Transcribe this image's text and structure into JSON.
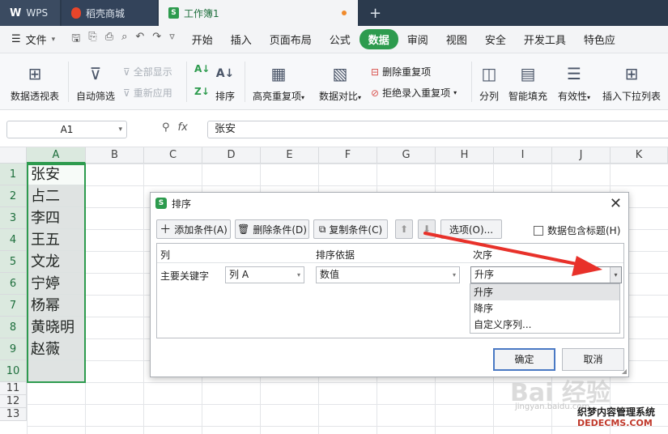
{
  "tabs": [
    {
      "label": "WPS",
      "logo": "W"
    },
    {
      "label": "稻壳商城"
    },
    {
      "label": "工作簿1"
    }
  ],
  "tab_plus": "+",
  "menu": {
    "file_label": "文件",
    "items": [
      "开始",
      "插入",
      "页面布局",
      "公式",
      "数据",
      "审阅",
      "视图",
      "安全",
      "开发工具",
      "特色应"
    ],
    "active": "数据"
  },
  "ribbon": {
    "pivot": "数据透视表",
    "autofilter": "自动筛选",
    "show_all": "全部显示",
    "reapply": "重新应用",
    "sort": "排序",
    "highlight_dup": "高亮重复项",
    "compare": "数据对比",
    "remove_dup": "删除重复项",
    "reject_dup": "拒绝录入重复项",
    "split": "分列",
    "smart_fill": "智能填充",
    "validity": "有效性",
    "insert_dropdown": "插入下拉列表"
  },
  "formula_bar": {
    "cell_ref": "A1",
    "fx": "fx",
    "value": "张安"
  },
  "grid": {
    "columns": [
      "A",
      "B",
      "C",
      "D",
      "E",
      "F",
      "G",
      "H",
      "I",
      "J",
      "K"
    ],
    "rows": [
      "1",
      "2",
      "3",
      "4",
      "5",
      "6",
      "7",
      "8",
      "9",
      "10",
      "11",
      "12",
      "13"
    ],
    "col_a_values": [
      "张安",
      "占二",
      "李四",
      "王五",
      "文龙",
      "宁婷",
      "杨幂",
      "黄晓明",
      "赵薇",
      ""
    ]
  },
  "dialog": {
    "title": "排序",
    "add_condition": "添加条件(A)",
    "delete_condition": "删除条件(D)",
    "copy_condition": "复制条件(C)",
    "options": "选项(O)...",
    "has_header": "数据包含标题(H)",
    "col_header": "列",
    "basis_header": "排序依据",
    "order_header": "次序",
    "primary_key": "主要关键字",
    "column_value": "列 A",
    "basis_value": "数值",
    "order_value": "升序",
    "order_options": [
      "升序",
      "降序",
      "自定义序列..."
    ],
    "ok": "确定",
    "cancel": "取消"
  },
  "watermark": {
    "brand": "Bai 经验",
    "url": "jingyan.baidu.com",
    "site_cn": "织梦内容管理系统",
    "site_en": "DEDECMS.COM"
  },
  "colors": {
    "accent": "#2d9b4e",
    "arrow": "#e8312a"
  }
}
